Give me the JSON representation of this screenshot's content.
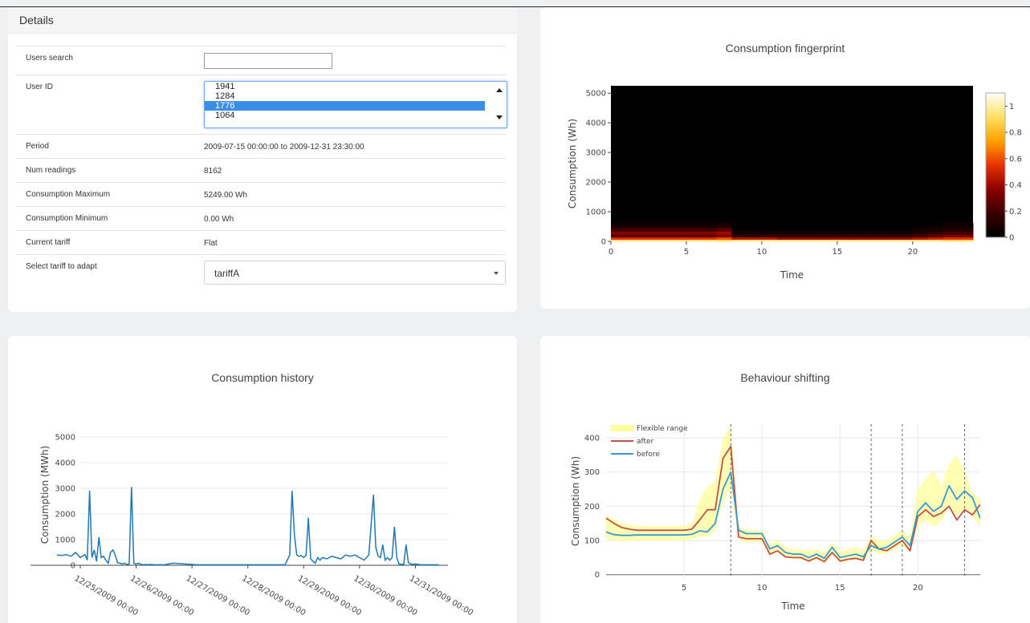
{
  "details": {
    "header": "Details",
    "users_search_label": "Users search",
    "users_search_value": "",
    "user_id_label": "User ID",
    "user_ids": [
      "1941",
      "1284",
      "1776",
      "1064"
    ],
    "selected_user_id": "1776",
    "period_label": "Period",
    "period_value": "2009-07-15 00:00:00 to 2009-12-31 23:30:00",
    "num_readings_label": "Num readings",
    "num_readings_value": "8162",
    "cons_max_label": "Consumption Maximum",
    "cons_max_value": "5249.00 Wh",
    "cons_min_label": "Consumption Minimum",
    "cons_min_value": "0.00 Wh",
    "tariff_label": "Current tariff",
    "tariff_value": "Flat",
    "select_tariff_label": "Select tariff to adapt",
    "select_tariff_value": "tariffA"
  },
  "chart_data": [
    {
      "id": "fingerprint",
      "type": "heatmap",
      "title": "Consumption fingerprint",
      "xlabel": "Time",
      "ylabel": "Consumption (Wh)",
      "xlim": [
        0,
        24
      ],
      "ylim": [
        0,
        5249
      ],
      "xticks": [
        0,
        5,
        10,
        15,
        20
      ],
      "yticks": [
        0,
        1000,
        2000,
        3000,
        4000,
        5000
      ],
      "colorbar_ticks": [
        0,
        0.2,
        0.4,
        0.6,
        0.8,
        1
      ],
      "colorbar_range": [
        0,
        1.1
      ],
      "colorscale": [
        "#000000",
        "#3a0000",
        "#8c0000",
        "#e63200",
        "#ffa000",
        "#ffe060",
        "#ffffff"
      ],
      "rows": [
        {
          "y0": 0,
          "y1": 60,
          "values": [
            0.95,
            0.95,
            0.95,
            0.95,
            0.95,
            0.95,
            0.95,
            0.9,
            0.95,
            0.95,
            0.95,
            0.95,
            0.95,
            0.95,
            0.95,
            0.95,
            0.95,
            0.95,
            0.95,
            0.95,
            0.95,
            0.95,
            0.9,
            0.9
          ]
        },
        {
          "y0": 60,
          "y1": 140,
          "values": [
            0.55,
            0.55,
            0.55,
            0.55,
            0.55,
            0.55,
            0.55,
            0.6,
            0.45,
            0.45,
            0.45,
            0.4,
            0.4,
            0.4,
            0.4,
            0.4,
            0.4,
            0.4,
            0.4,
            0.4,
            0.45,
            0.5,
            0.55,
            0.55
          ]
        },
        {
          "y0": 140,
          "y1": 240,
          "values": [
            0.25,
            0.25,
            0.25,
            0.25,
            0.25,
            0.25,
            0.25,
            0.35,
            0.15,
            0.15,
            0.15,
            0.15,
            0.15,
            0.15,
            0.15,
            0.15,
            0.15,
            0.15,
            0.15,
            0.15,
            0.2,
            0.25,
            0.3,
            0.3
          ]
        },
        {
          "y0": 240,
          "y1": 340,
          "values": [
            0.35,
            0.35,
            0.35,
            0.35,
            0.35,
            0.35,
            0.35,
            0.4,
            0.05,
            0.05,
            0.05,
            0.05,
            0.05,
            0.05,
            0.05,
            0.05,
            0.05,
            0.05,
            0.05,
            0.05,
            0.1,
            0.15,
            0.2,
            0.2
          ]
        },
        {
          "y0": 340,
          "y1": 460,
          "values": [
            0.2,
            0.2,
            0.2,
            0.2,
            0.2,
            0.2,
            0.2,
            0.25,
            0.02,
            0.02,
            0.02,
            0.02,
            0.02,
            0.02,
            0.02,
            0.02,
            0.02,
            0.02,
            0.02,
            0.02,
            0.05,
            0.08,
            0.1,
            0.1
          ]
        },
        {
          "y0": 460,
          "y1": 620,
          "values": [
            0.06,
            0.06,
            0.06,
            0.06,
            0.06,
            0.06,
            0.06,
            0.08,
            0.0,
            0.0,
            0.0,
            0.0,
            0.0,
            0.0,
            0.0,
            0.0,
            0.0,
            0.0,
            0.0,
            0.0,
            0.02,
            0.03,
            0.05,
            0.05
          ]
        }
      ]
    },
    {
      "id": "history",
      "type": "line",
      "title": "Consumption history",
      "xlabel": "",
      "ylabel": "Consumption (MWh)",
      "xlim": [
        0,
        158
      ],
      "ylim": [
        0,
        5500
      ],
      "yticks": [
        0,
        1000,
        2000,
        3000,
        4000,
        5000
      ],
      "xtick_labels": [
        "12/25/2009 00:00",
        "12/26/2009 00:00",
        "12/27/2009 00:00",
        "12/28/2009 00:00",
        "12/29/2009 00:00",
        "12/30/2009 00:00",
        "12/31/2009 00:00"
      ],
      "xtick_positions": [
        0,
        24,
        48,
        72,
        96,
        120,
        144
      ],
      "series": [
        {
          "color": "#1f77b4",
          "x": [
            -10,
            -8,
            -6,
            -4,
            -2,
            0,
            2,
            3,
            4,
            5,
            6,
            7,
            8,
            9,
            10,
            11,
            12,
            13,
            14,
            15,
            16,
            17,
            18,
            19,
            20,
            21,
            22,
            23,
            24,
            25,
            26,
            27,
            28,
            29,
            30,
            32,
            34,
            36,
            40,
            50,
            60,
            70,
            80,
            88,
            90,
            91,
            92,
            93,
            94,
            95,
            96,
            97,
            98,
            99,
            100,
            101,
            102,
            103,
            104,
            106,
            108,
            110,
            112,
            114,
            116,
            118,
            120,
            122,
            124,
            126,
            127,
            128,
            129,
            130,
            131,
            132,
            133,
            134,
            135,
            136,
            137,
            138,
            139,
            140,
            141,
            142,
            143,
            144,
            145,
            146,
            148,
            150,
            152,
            154
          ],
          "y": [
            400,
            380,
            420,
            350,
            500,
            300,
            420,
            200,
            2900,
            300,
            600,
            150,
            1100,
            300,
            350,
            200,
            80,
            500,
            600,
            400,
            100,
            80,
            50,
            80,
            30,
            50,
            3050,
            80,
            40,
            80,
            40,
            20,
            30,
            20,
            30,
            20,
            20,
            20,
            80,
            20,
            20,
            20,
            20,
            20,
            400,
            2900,
            1200,
            400,
            350,
            380,
            300,
            380,
            1850,
            250,
            150,
            80,
            300,
            200,
            300,
            250,
            350,
            300,
            250,
            400,
            350,
            400,
            300,
            200,
            400,
            2750,
            700,
            350,
            300,
            800,
            200,
            300,
            200,
            300,
            1500,
            300,
            50,
            30,
            40,
            800,
            100,
            50,
            30,
            50,
            40,
            20,
            20,
            20,
            20,
            20
          ]
        }
      ]
    },
    {
      "id": "shifting",
      "type": "line",
      "title": "Behaviour shifting",
      "xlabel": "Time",
      "ylabel": "Consumption (Wh)",
      "xlim": [
        0,
        24
      ],
      "ylim": [
        -10,
        440
      ],
      "xticks": [
        5,
        10,
        15,
        20
      ],
      "yticks": [
        0,
        100,
        200,
        300,
        400
      ],
      "vlines": [
        8,
        17,
        19,
        23
      ],
      "legend": [
        {
          "name": "Flexible range",
          "color": "#ffff99"
        },
        {
          "name": "after",
          "color": "#c0504d"
        },
        {
          "name": "before",
          "color": "#3498db"
        }
      ],
      "x": [
        0,
        0.5,
        1,
        1.5,
        2,
        2.5,
        3,
        3.5,
        4,
        4.5,
        5,
        5.5,
        6,
        6.5,
        7,
        7.5,
        8,
        8.5,
        9,
        9.5,
        10,
        10.5,
        11,
        11.5,
        12,
        12.5,
        13,
        13.5,
        14,
        14.5,
        15,
        15.5,
        16,
        16.5,
        17,
        17.5,
        18,
        18.5,
        19,
        19.5,
        20,
        20.5,
        21,
        21.5,
        22,
        22.5,
        23,
        23.5,
        24
      ],
      "before": [
        125,
        117,
        115,
        115,
        116,
        116,
        116,
        116,
        116,
        116,
        116,
        118,
        128,
        125,
        150,
        250,
        300,
        130,
        120,
        120,
        120,
        75,
        85,
        65,
        60,
        60,
        50,
        60,
        48,
        80,
        50,
        55,
        60,
        52,
        85,
        75,
        80,
        95,
        110,
        85,
        185,
        210,
        185,
        200,
        260,
        220,
        245,
        225,
        165
      ],
      "after": [
        165,
        150,
        138,
        133,
        130,
        130,
        130,
        130,
        130,
        130,
        130,
        133,
        160,
        190,
        190,
        340,
        375,
        110,
        105,
        105,
        105,
        60,
        70,
        52,
        50,
        50,
        40,
        50,
        38,
        65,
        40,
        45,
        48,
        42,
        100,
        75,
        70,
        85,
        100,
        70,
        170,
        190,
        170,
        180,
        200,
        160,
        190,
        175,
        205
      ],
      "upper": [
        175,
        162,
        150,
        145,
        143,
        143,
        143,
        143,
        143,
        143,
        143,
        148,
        220,
        260,
        270,
        400,
        435,
        140,
        130,
        130,
        130,
        90,
        100,
        80,
        75,
        75,
        70,
        75,
        65,
        95,
        70,
        75,
        80,
        70,
        115,
        100,
        100,
        115,
        130,
        110,
        250,
        280,
        305,
        260,
        325,
        350,
        300,
        240,
        220
      ],
      "lower": [
        105,
        100,
        98,
        98,
        100,
        100,
        100,
        100,
        100,
        100,
        100,
        102,
        112,
        110,
        130,
        210,
        255,
        100,
        95,
        95,
        95,
        55,
        65,
        50,
        45,
        45,
        35,
        45,
        33,
        60,
        35,
        40,
        45,
        38,
        70,
        60,
        62,
        75,
        85,
        65,
        140,
        160,
        140,
        155,
        200,
        170,
        190,
        170,
        140
      ]
    }
  ]
}
